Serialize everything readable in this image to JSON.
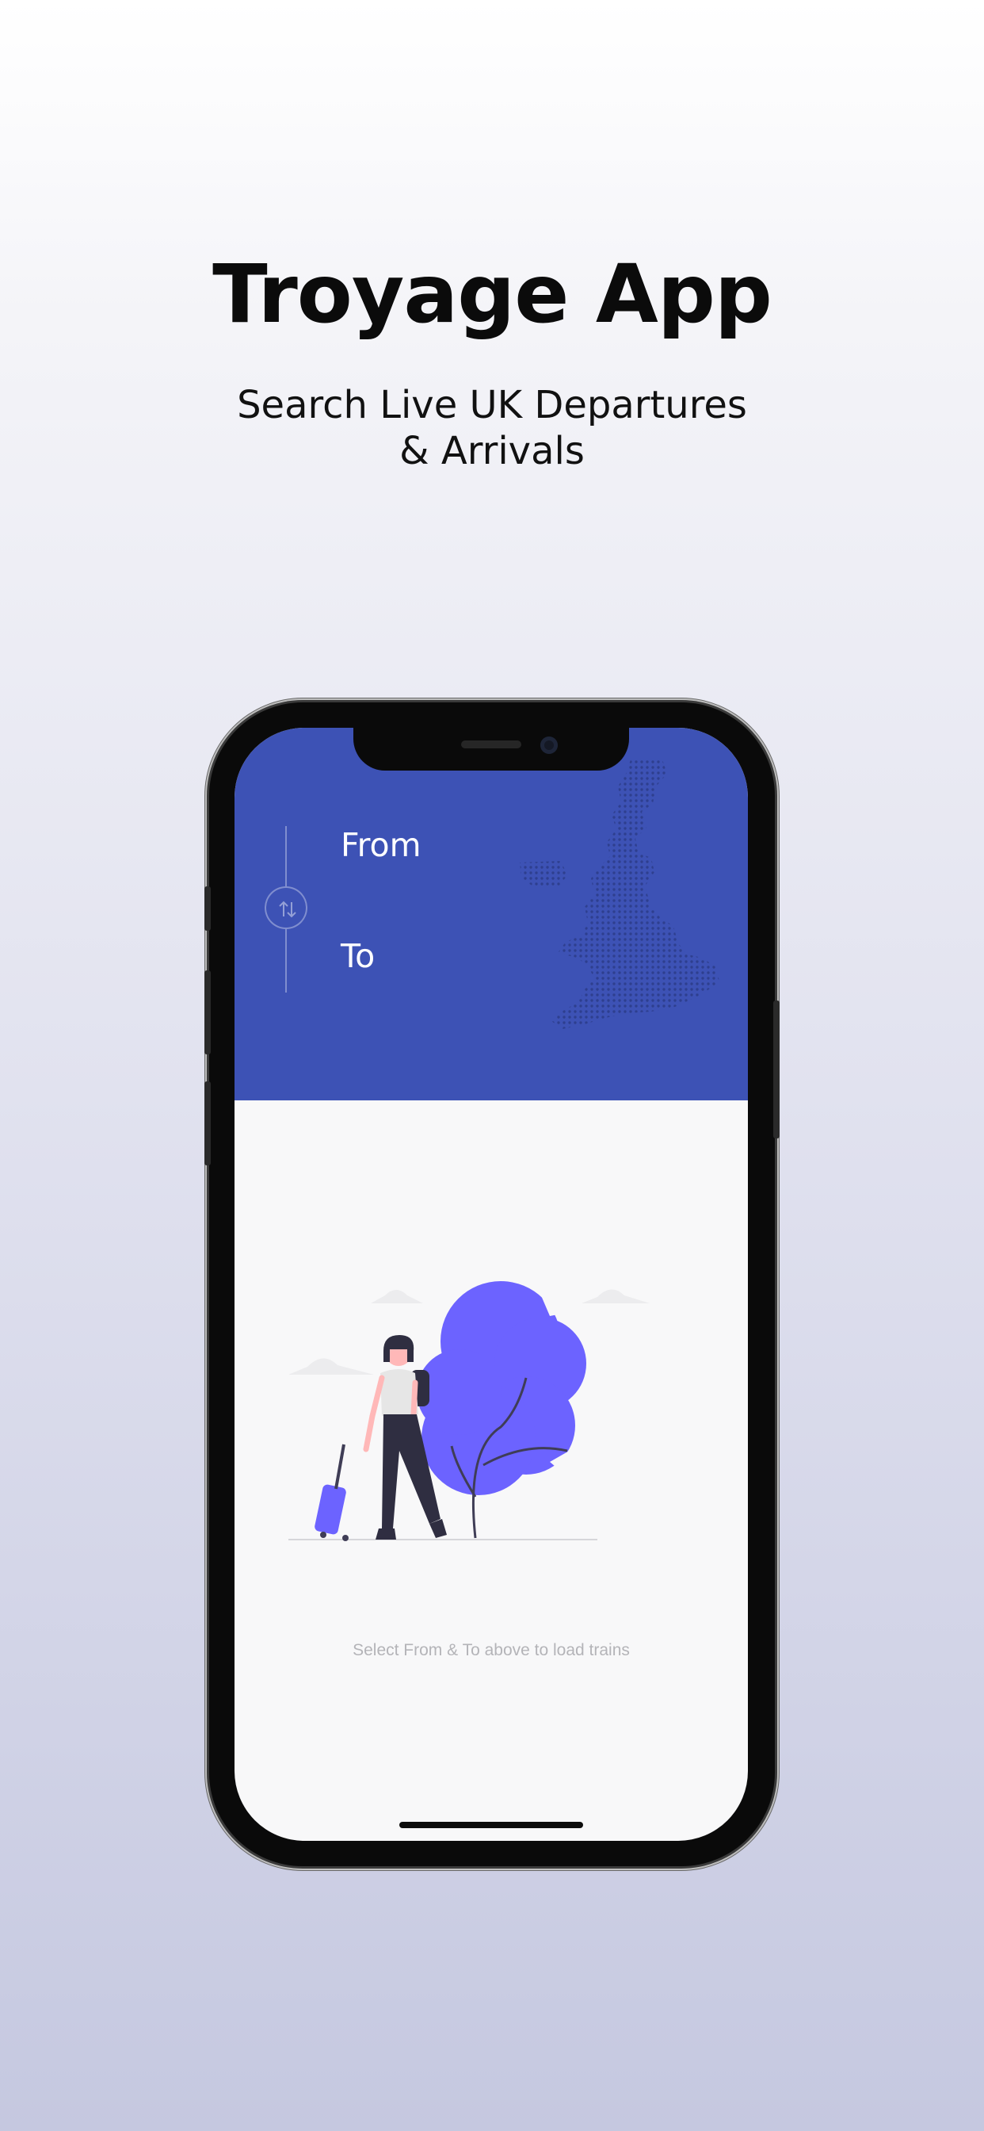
{
  "promo": {
    "title": "Troyage App",
    "subtitle_lines": [
      "Search Live UK Departures",
      "& Arrivals"
    ]
  },
  "app": {
    "from_label": "From",
    "to_label": "To",
    "empty_state_message": "Select From & To above to load trains"
  },
  "icons": {
    "swap": "swap-vertical-arrows-icon",
    "map": "uk-dot-map-icon"
  },
  "colors": {
    "header": "#3d52b5",
    "accent": "#6c63ff",
    "screen_background": "#f8f8f9"
  }
}
